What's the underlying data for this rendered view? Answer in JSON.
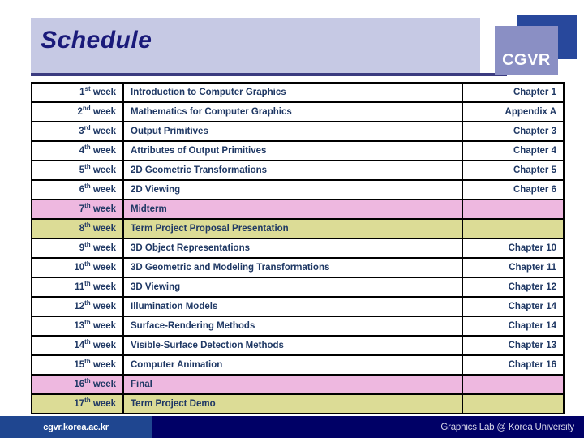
{
  "slide": {
    "title": "Schedule",
    "logo": "CGVR"
  },
  "table": {
    "rows": [
      {
        "week": "1",
        "ord": "st",
        "week_suffix": " week",
        "topic": "Introduction to Computer Graphics",
        "chapter": "Chapter 1",
        "style": "normal"
      },
      {
        "week": "2",
        "ord": "nd",
        "week_suffix": " week",
        "topic": "Mathematics for Computer Graphics",
        "chapter": "Appendix A",
        "style": "normal"
      },
      {
        "week": "3",
        "ord": "rd",
        "week_suffix": " week",
        "topic": "Output Primitives",
        "chapter": "Chapter 3",
        "style": "normal"
      },
      {
        "week": "4",
        "ord": "th",
        "week_suffix": " week",
        "topic": "Attributes of Output Primitives",
        "chapter": "Chapter 4",
        "style": "normal"
      },
      {
        "week": "5",
        "ord": "th",
        "week_suffix": " week",
        "topic": "2D Geometric Transformations",
        "chapter": "Chapter 5",
        "style": "normal"
      },
      {
        "week": "6",
        "ord": "th",
        "week_suffix": " week",
        "topic": "2D Viewing",
        "chapter": "Chapter 6",
        "style": "normal"
      },
      {
        "week": "7",
        "ord": "th",
        "week_suffix": " week",
        "topic": "Midterm",
        "chapter": "",
        "style": "exam"
      },
      {
        "week": "8",
        "ord": "th",
        "week_suffix": " week",
        "topic": "Term Project Proposal Presentation",
        "chapter": "",
        "style": "project"
      },
      {
        "week": "9",
        "ord": "th",
        "week_suffix": " week",
        "topic": "3D Object Representations",
        "chapter": "Chapter 10",
        "style": "normal"
      },
      {
        "week": "10",
        "ord": "th",
        "week_suffix": " week",
        "topic": "3D Geometric and Modeling Transformations",
        "chapter": "Chapter 11",
        "style": "normal"
      },
      {
        "week": "11",
        "ord": "th",
        "week_suffix": " week",
        "topic": "3D Viewing",
        "chapter": "Chapter 12",
        "style": "normal"
      },
      {
        "week": "12",
        "ord": "th",
        "week_suffix": " week",
        "topic": "Illumination Models",
        "chapter": "Chapter 14",
        "style": "normal"
      },
      {
        "week": "13",
        "ord": "th",
        "week_suffix": " week",
        "topic": "Surface-Rendering Methods",
        "chapter": "Chapter 14",
        "style": "normal"
      },
      {
        "week": "14",
        "ord": "th",
        "week_suffix": " week",
        "topic": "Visible-Surface Detection Methods",
        "chapter": "Chapter 13",
        "style": "normal"
      },
      {
        "week": "15",
        "ord": "th",
        "week_suffix": " week",
        "topic": "Computer Animation",
        "chapter": "Chapter 16",
        "style": "normal"
      },
      {
        "week": "16",
        "ord": "th",
        "week_suffix": " week",
        "topic": "Final",
        "chapter": "",
        "style": "exam"
      },
      {
        "week": "17",
        "ord": "th",
        "week_suffix": " week",
        "topic": "Term Project Demo",
        "chapter": "",
        "style": "project"
      }
    ]
  },
  "footer": {
    "left": "cgvr.korea.ac.kr",
    "right": "Graphics Lab @ Korea University"
  },
  "colors": {
    "title_band": "#c6c9e4",
    "title_text": "#1a1a7a",
    "logo_back": "#28489c",
    "logo_front": "#8a8fc4",
    "exam_row": "#eeb8e0",
    "project_row": "#dcdc96",
    "footer_left": "#1f4690",
    "footer_right": "#000066",
    "cell_text": "#1f3864"
  }
}
